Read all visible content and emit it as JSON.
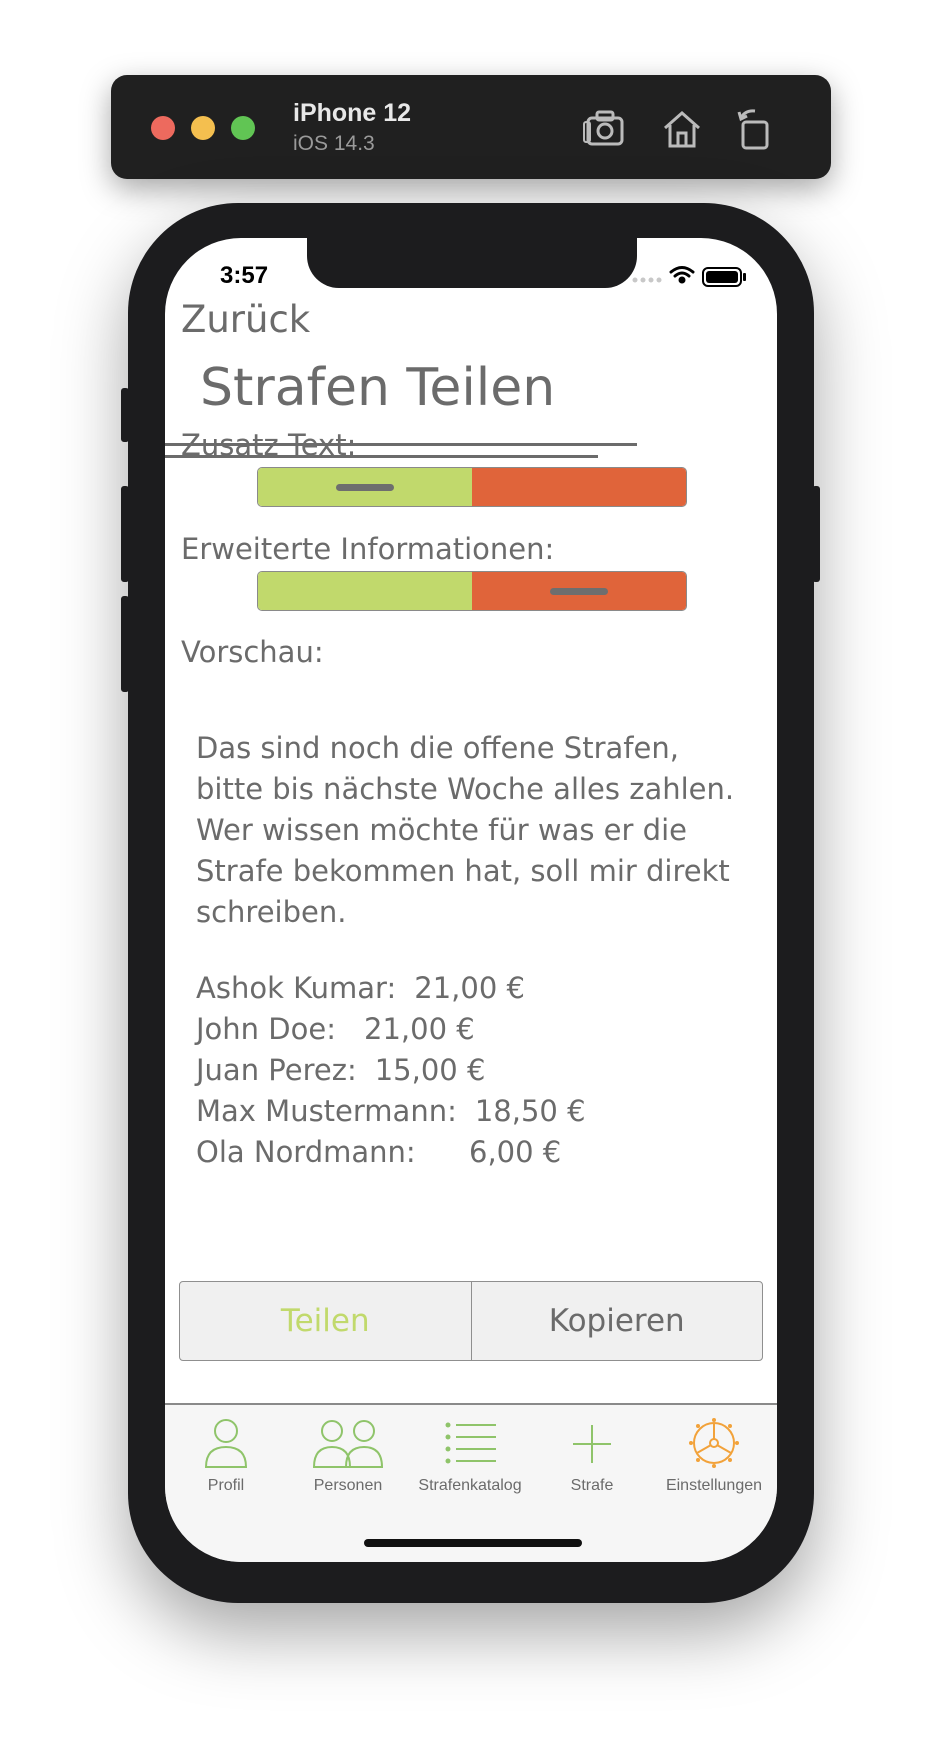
{
  "simulator": {
    "device": "iPhone 12",
    "os": "iOS 14.3",
    "icons": [
      "screenshot-icon",
      "home-icon",
      "rotate-icon"
    ]
  },
  "status_bar": {
    "time": "3:57"
  },
  "nav": {
    "back_label": "Zurück"
  },
  "page": {
    "title": "Strafen Teilen"
  },
  "options": {
    "extra_text": {
      "label": "Zusatz Text:",
      "selected": "on"
    },
    "extended_info": {
      "label": "Erweiterte Informationen:",
      "selected": "off"
    }
  },
  "preview": {
    "label": "Vorschau:",
    "message": "Das sind noch die offene Strafen,\nbitte bis nächste Woche alles zahlen.\nWer wissen möchte für was er die\nStrafe bekommen hat, soll mir direkt\nschreiben.",
    "fines": [
      {
        "name": "Ashok Kumar:",
        "amount": "21,00 €"
      },
      {
        "name": "John Doe:",
        "amount": "21,00 €"
      },
      {
        "name": "Juan Perez:",
        "amount": "15,00 €"
      },
      {
        "name": "Max Mustermann:",
        "amount": "18,50 €"
      },
      {
        "name": "Ola Nordmann:",
        "amount": "6,00 €"
      }
    ]
  },
  "actions": {
    "share_label": "Teilen",
    "copy_label": "Kopieren"
  },
  "tabbar": {
    "items": [
      {
        "label": "Profil",
        "icon": "person-icon"
      },
      {
        "label": "Personen",
        "icon": "people-icon"
      },
      {
        "label": "Strafenkatalog",
        "icon": "list-icon"
      },
      {
        "label": "Strafe",
        "icon": "plus-icon"
      },
      {
        "label": "Einstellungen",
        "icon": "settings-wheel-icon",
        "active": true
      }
    ]
  },
  "colors": {
    "on": "#c1d96c",
    "off": "#e0643a",
    "text": "#6b6b6b",
    "tab_icon": "#8fc46a",
    "tab_active": "#f2a23a"
  }
}
